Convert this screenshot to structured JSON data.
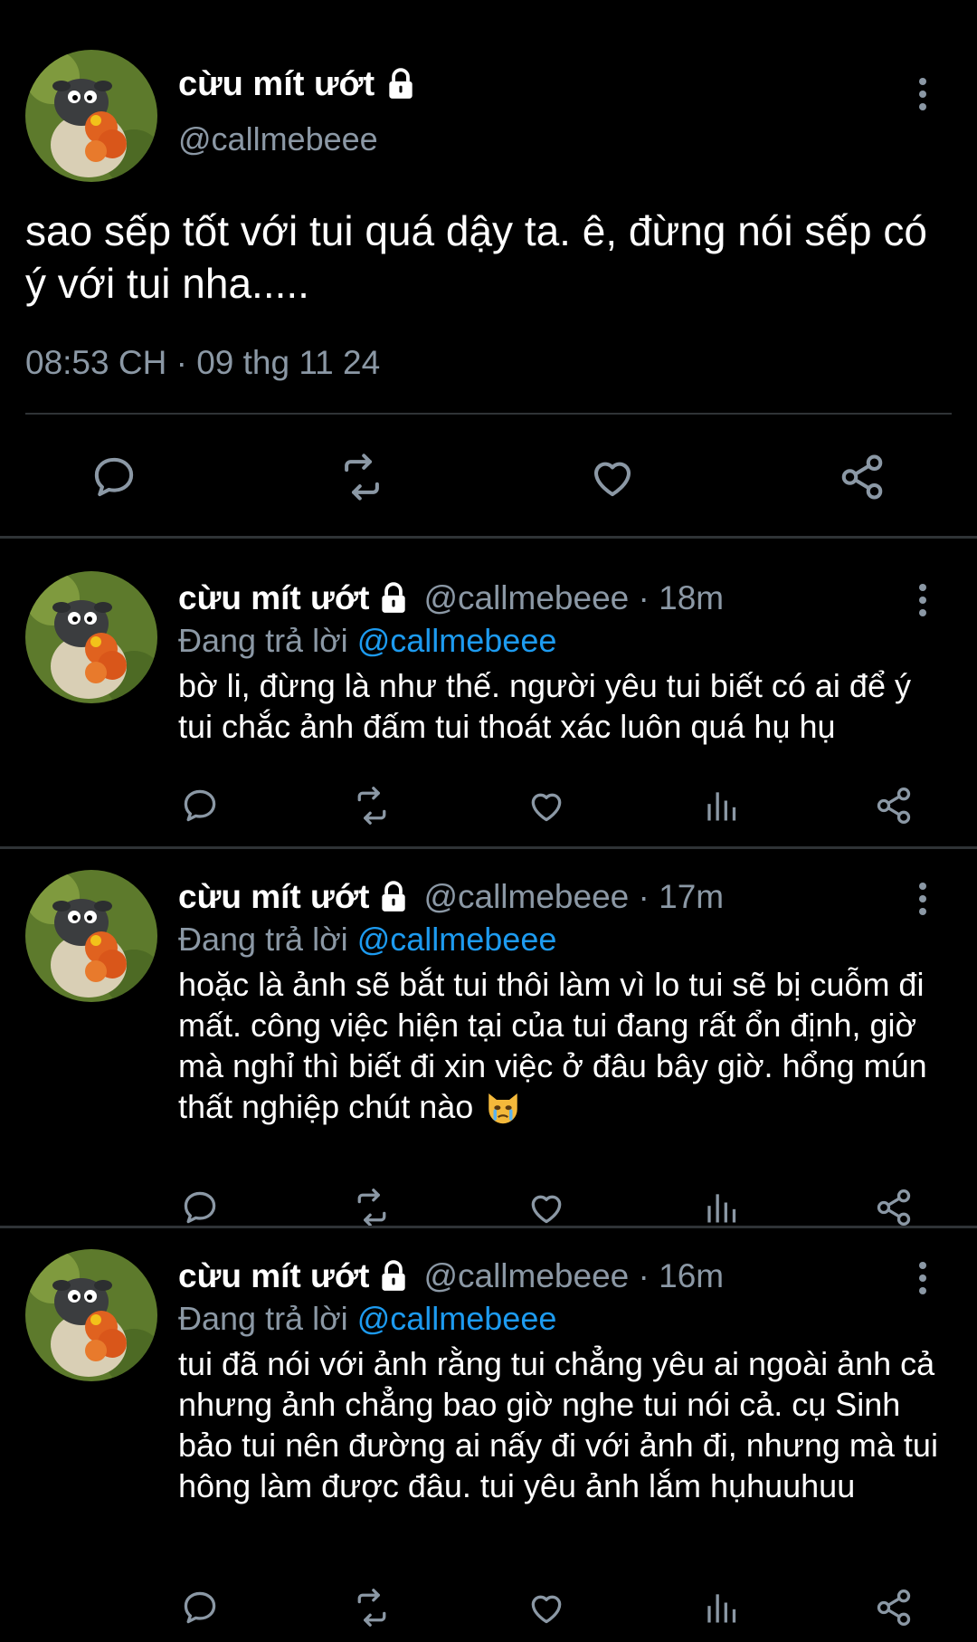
{
  "main_tweet": {
    "display_name": "cừu mít ướt",
    "handle": "@callmebeee",
    "text": "sao sếp tốt với tui quá dậy ta. ê, đừng nói sếp có ý với tui nha.....",
    "timestamp": "08:53 CH · 09 thg 11 24",
    "actions": [
      "reply-icon",
      "retweet-icon",
      "like-icon",
      "share-icon"
    ]
  },
  "replies": [
    {
      "display_name": "cừu mít ướt",
      "handle_time": "@callmebeee · 18m",
      "replying_prefix": "Đang trả lời",
      "replying_handle": "@callmebeee",
      "text": "bờ li, đừng là như thế. người yêu tui biết có ai để ý tui chắc ảnh đấm tui thoát xác luôn quá hụ hụ"
    },
    {
      "display_name": "cừu mít ướt",
      "handle_time": "@callmebeee · 17m",
      "replying_prefix": "Đang trả lời",
      "replying_handle": "@callmebeee",
      "text": "hoặc là ảnh sẽ bắt tui thôi làm vì lo tui sẽ bị cuỗm đi mất. công việc hiện tại của tui đang rất ổn định, giờ mà nghỉ thì biết đi xin việc ở đâu bây giờ. hổng mún thất nghiệp chút nào",
      "emoji": "crying-cat-emoji"
    },
    {
      "display_name": "cừu mít ướt",
      "handle_time": "@callmebeee · 16m",
      "replying_prefix": "Đang trả lời",
      "replying_handle": "@callmebeee",
      "text": "tui đã nói với ảnh rằng tui chẳng yêu ai ngoài ảnh cả nhưng ảnh chẳng bao giờ nghe tui nói cả. cụ Sinh bảo tui nên đường ai nấy đi với ảnh đi, nhưng mà tui hông làm được đâu. tui yêu ảnh lắm hụhuuhuu"
    }
  ],
  "colors": {
    "background": "#000000",
    "text": "#ffffff",
    "secondary": "#8b98a5",
    "mention": "#1d9bf0",
    "divider": "#2f3336"
  }
}
